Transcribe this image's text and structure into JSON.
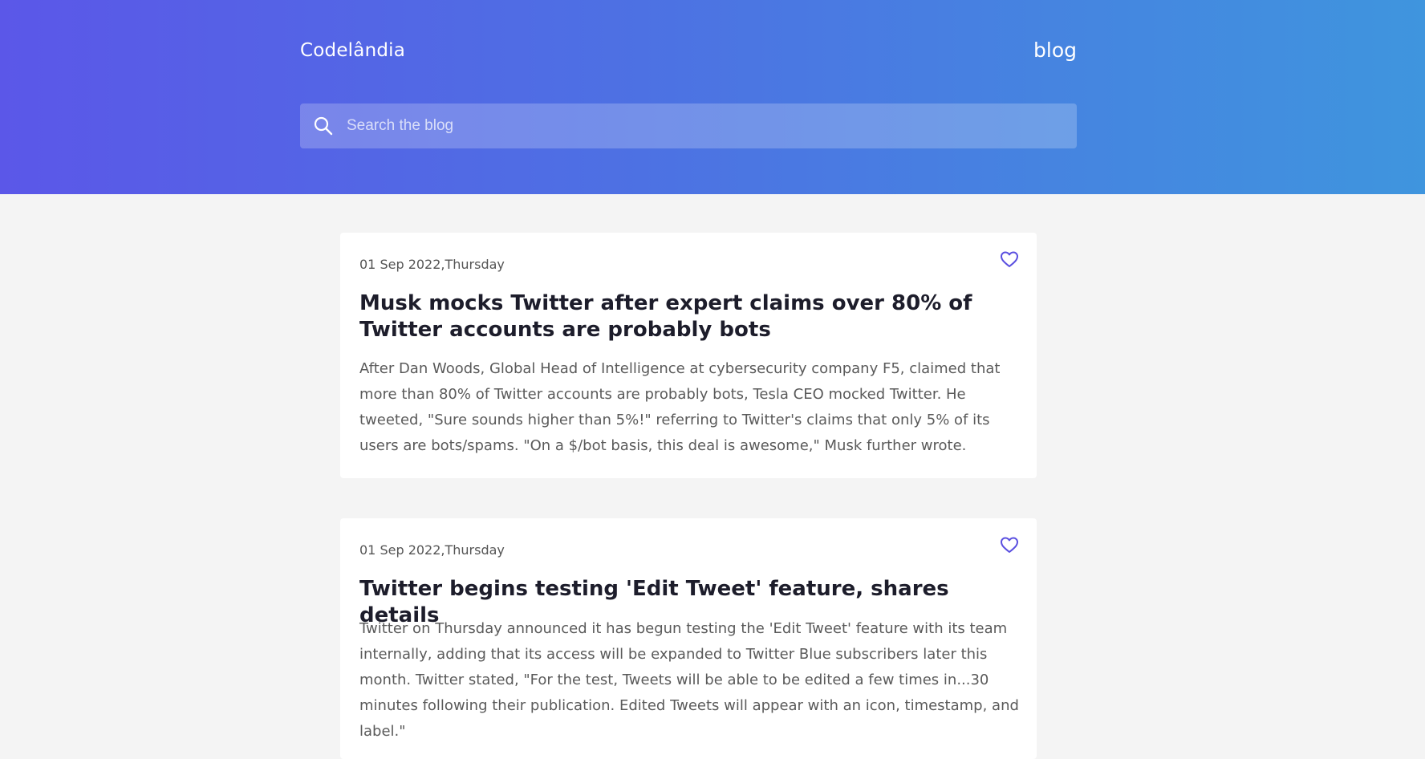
{
  "header": {
    "brand": "Codelândia",
    "nav_link": "blog",
    "search_placeholder": "Search the blog"
  },
  "posts": [
    {
      "date": "01 Sep 2022,Thursday",
      "title": "Musk mocks Twitter after expert claims over 80% of Twitter accounts are probably bots",
      "body": "After Dan Woods, Global Head of Intelligence at cybersecurity company F5, claimed that more than 80% of Twitter accounts are probably bots, Tesla CEO mocked Twitter. He tweeted, \"Sure sounds higher than 5%!\" referring to Twitter's claims that only 5% of its users are bots/spams. \"On a $/bot basis, this deal is awesome,\" Musk further wrote.",
      "liked": false
    },
    {
      "date": "01 Sep 2022,Thursday",
      "title": "Twitter begins testing 'Edit Tweet' feature, shares details",
      "body": "Twitter on Thursday announced it has begun testing the 'Edit Tweet' feature with its team internally, adding that its access will be expanded to Twitter Blue subscribers later this month. Twitter stated, \"For the test, Tweets will be able to be edited a few times in...30 minutes following their publication. Edited Tweets will appear with an icon, timestamp, and label.\"",
      "liked": false
    }
  ],
  "colors": {
    "gradient_start": "#5b57e8",
    "gradient_end": "#3f95de",
    "accent": "#5a4fe0",
    "background": "#f4f4f4"
  },
  "icons": {
    "search": "search-icon",
    "like": "heart-outline-icon"
  }
}
